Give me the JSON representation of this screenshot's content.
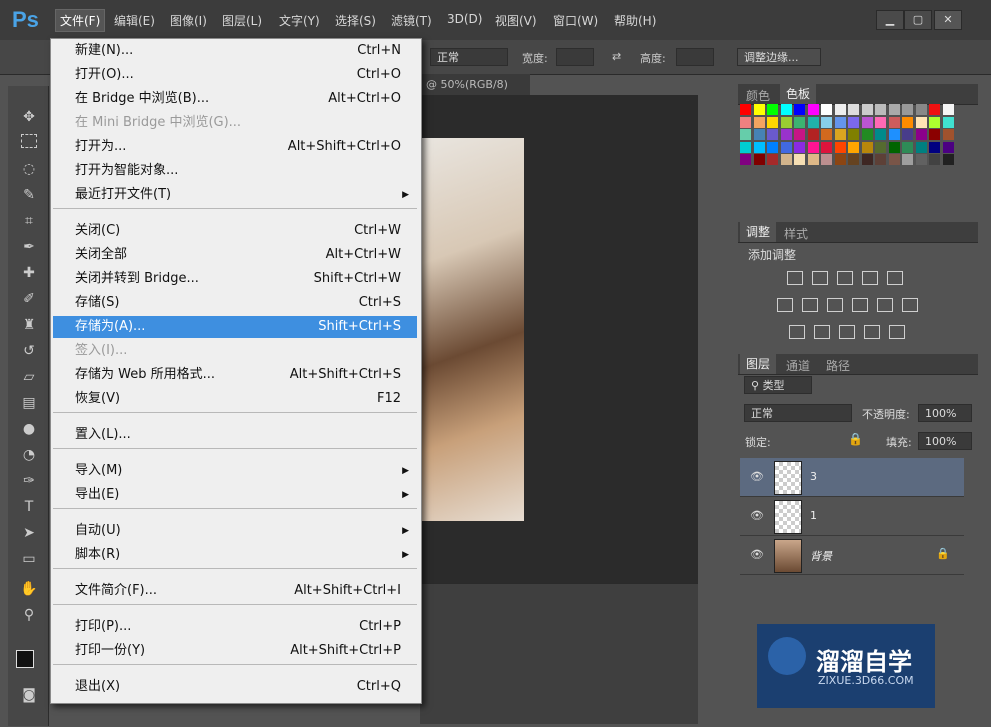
{
  "app": {
    "logo": "Ps"
  },
  "menubar": [
    "文件(F)",
    "编辑(E)",
    "图像(I)",
    "图层(L)",
    "文字(Y)",
    "选择(S)",
    "滤镜(T)",
    "3D(D)",
    "视图(V)",
    "窗口(W)",
    "帮助(H)"
  ],
  "options": {
    "mode": "正常",
    "width_label": "宽度:",
    "height_label": "高度:",
    "refine_button": "调整边缘..."
  },
  "document": {
    "tab_title": "@ 50%(RGB/8)"
  },
  "file_menu": [
    {
      "label": "新建(N)...",
      "shortcut": "Ctrl+N"
    },
    {
      "label": "打开(O)...",
      "shortcut": "Ctrl+O"
    },
    {
      "label": "在 Bridge 中浏览(B)...",
      "shortcut": "Alt+Ctrl+O"
    },
    {
      "label": "在 Mini Bridge 中浏览(G)...",
      "shortcut": "",
      "disabled": true
    },
    {
      "label": "打开为...",
      "shortcut": "Alt+Shift+Ctrl+O"
    },
    {
      "label": "打开为智能对象...",
      "shortcut": ""
    },
    {
      "label": "最近打开文件(T)",
      "shortcut": "",
      "submenu": true
    },
    {
      "label": "关闭(C)",
      "shortcut": "Ctrl+W"
    },
    {
      "label": "关闭全部",
      "shortcut": "Alt+Ctrl+W"
    },
    {
      "label": "关闭并转到 Bridge...",
      "shortcut": "Shift+Ctrl+W"
    },
    {
      "label": "存储(S)",
      "shortcut": "Ctrl+S"
    },
    {
      "label": "存储为(A)...",
      "shortcut": "Shift+Ctrl+S",
      "highlighted": true
    },
    {
      "label": "签入(I)...",
      "shortcut": "",
      "disabled": true
    },
    {
      "label": "存储为 Web 所用格式...",
      "shortcut": "Alt+Shift+Ctrl+S"
    },
    {
      "label": "恢复(V)",
      "shortcut": "F12"
    },
    {
      "label": "置入(L)...",
      "shortcut": ""
    },
    {
      "label": "导入(M)",
      "shortcut": "",
      "submenu": true
    },
    {
      "label": "导出(E)",
      "shortcut": "",
      "submenu": true
    },
    {
      "label": "自动(U)",
      "shortcut": "",
      "submenu": true
    },
    {
      "label": "脚本(R)",
      "shortcut": "",
      "submenu": true
    },
    {
      "label": "文件简介(F)...",
      "shortcut": "Alt+Shift+Ctrl+I"
    },
    {
      "label": "打印(P)...",
      "shortcut": "Ctrl+P"
    },
    {
      "label": "打印一份(Y)",
      "shortcut": "Alt+Shift+Ctrl+P"
    },
    {
      "label": "退出(X)",
      "shortcut": "Ctrl+Q"
    }
  ],
  "panels": {
    "swatch_tabs": [
      "颜色",
      "色板"
    ],
    "adjust_tabs": [
      "调整",
      "样式"
    ],
    "adjust_title": "添加调整",
    "layer_tabs": [
      "图层",
      "通道",
      "路径"
    ],
    "layer_kind": "类型",
    "blend_mode": "正常",
    "opacity_label": "不透明度:",
    "opacity_value": "100%",
    "lock_label": "锁定:",
    "fill_label": "填充:",
    "fill_value": "100%",
    "layers": [
      {
        "name": "3",
        "selected": true
      },
      {
        "name": "1",
        "selected": false
      },
      {
        "name": "背景",
        "selected": false
      }
    ]
  },
  "watermark": {
    "brand": "溜溜自学",
    "site": "ZIXUE.3D66.COM"
  },
  "swatch_colors": [
    "#ff0000",
    "#ffff00",
    "#00ff00",
    "#00ffff",
    "#0000ff",
    "#ff00ff",
    "#ffffff",
    "#eeeeee",
    "#dddddd",
    "#cccccc",
    "#bbbbbb",
    "#aaaaaa",
    "#999999",
    "#888888",
    "#ee1111",
    "#f5f5f5",
    "#f08080",
    "#f4a460",
    "#ffd700",
    "#9acd32",
    "#3cb371",
    "#20b2aa",
    "#87ceeb",
    "#6495ed",
    "#7b68ee",
    "#ba55d3",
    "#ff69b4",
    "#cd5c5c",
    "#ff8c00",
    "#ffe4b5",
    "#adff2f",
    "#40e0d0",
    "#66cdaa",
    "#4682b4",
    "#6a5acd",
    "#9932cc",
    "#c71585",
    "#b22222",
    "#d2691e",
    "#daa520",
    "#808000",
    "#228b22",
    "#008b8b",
    "#1e90ff",
    "#483d8b",
    "#8b008b",
    "#8b0000",
    "#a0522d",
    "#00ced1",
    "#00bfff",
    "#0080ff",
    "#4169e1",
    "#8a2be2",
    "#ff1493",
    "#dc143c",
    "#ff4500",
    "#ffa500",
    "#b8860b",
    "#556b2f",
    "#006400",
    "#2e8b57",
    "#008080",
    "#000080",
    "#4b0082",
    "#800080",
    "#800000",
    "#a52a2a",
    "#d2b48c",
    "#f5deb3",
    "#deb887",
    "#bc8f8f",
    "#8b4513",
    "#654321",
    "#3e2723",
    "#5d4037",
    "#795548",
    "#9e9e9e",
    "#616161",
    "#424242",
    "#212121"
  ]
}
